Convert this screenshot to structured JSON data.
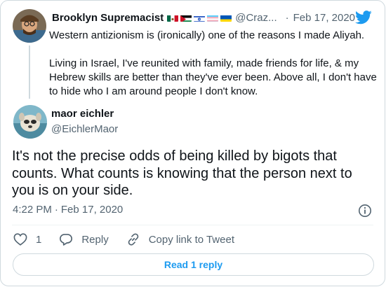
{
  "parent_tweet": {
    "name": "Brooklyn Supremacist",
    "handle": "@Craz...",
    "separator": "·",
    "date": "Feb 17, 2020",
    "flags": [
      "mexico-flag",
      "jordan-flag",
      "israel-flag",
      "transgender-flag",
      "ukraine-flag"
    ],
    "paragraphs": [
      "Western antizionism is (ironically) one of the reasons I made Aliyah.",
      "Living in Israel, I've reunited with family, made friends for life, & my Hebrew skills are better than they've ever been. Above all, I don't have to hide who I am around people I don't know."
    ]
  },
  "main_tweet": {
    "name": "maor eichler",
    "handle": "@EichlerMaor",
    "text": "It's not the precise odds of being killed by bigots that counts. What counts is knowing that the person next to you is on your side.",
    "time": "4:22 PM",
    "separator": "·",
    "date": "Feb 17, 2020"
  },
  "actions": {
    "like_count": "1",
    "reply_label": "Reply",
    "copy_link_label": "Copy link to Tweet"
  },
  "read_replies_label": "Read 1 reply",
  "colors": {
    "accent": "#1d9bf0",
    "text": "#0f1419",
    "muted": "#536471",
    "border": "#cfd9de"
  },
  "icons": [
    "twitter-bird-icon",
    "info-icon",
    "heart-icon",
    "reply-icon",
    "link-icon"
  ]
}
